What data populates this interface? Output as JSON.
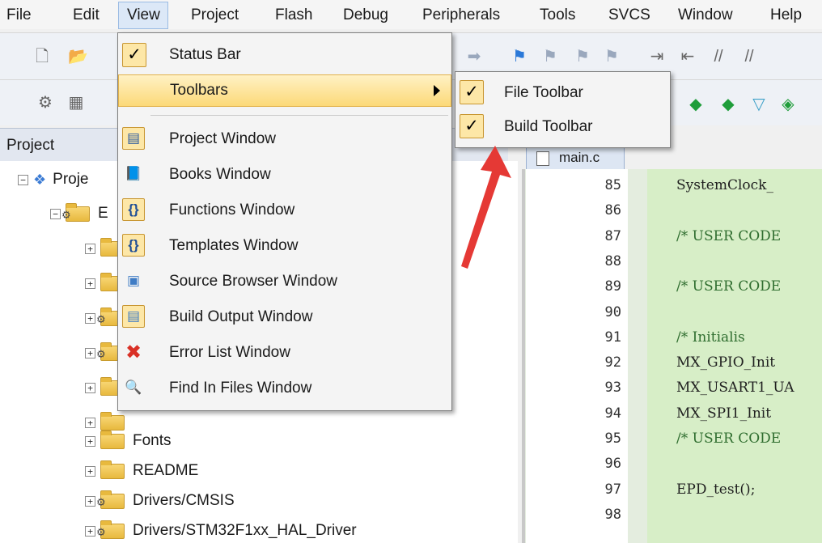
{
  "menubar": {
    "items": [
      "File",
      "Edit",
      "View",
      "Project",
      "Flash",
      "Debug",
      "Peripherals",
      "Tools",
      "SVCS",
      "Window",
      "Help"
    ]
  },
  "view_menu": {
    "status_bar": "Status Bar",
    "toolbars": "Toolbars",
    "items": [
      {
        "label": "Project Window",
        "icon": "project-window-icon"
      },
      {
        "label": "Books Window",
        "icon": "books-window-icon"
      },
      {
        "label": "Functions Window",
        "icon": "functions-window-icon"
      },
      {
        "label": "Templates Window",
        "icon": "templates-window-icon"
      },
      {
        "label": "Source Browser Window",
        "icon": "source-browser-icon"
      },
      {
        "label": "Build Output Window",
        "icon": "build-output-icon"
      },
      {
        "label": "Error List Window",
        "icon": "error-list-icon"
      },
      {
        "label": "Find In Files Window",
        "icon": "find-in-files-icon"
      }
    ]
  },
  "toolbars_submenu": {
    "file_toolbar": "File Toolbar",
    "build_toolbar": "Build Toolbar"
  },
  "checkmark": "✓",
  "project_pane": {
    "title": "Project",
    "root_label": "Proje",
    "target_label": "E",
    "folders": [
      "Fonts",
      "README",
      "Drivers/CMSIS",
      "Drivers/STM32F1xx_HAL_Driver"
    ]
  },
  "editor": {
    "tab_label": "main.c",
    "line_numbers": [
      "85",
      "86",
      "87",
      "88",
      "89",
      "90",
      "91",
      "92",
      "93",
      "94",
      "95",
      "96",
      "97",
      "98"
    ],
    "code_lines": [
      "SystemClock_",
      "",
      "/* USER CODE",
      "",
      "/* USER CODE",
      "",
      "/* Initialis",
      "MX_GPIO_Init",
      "MX_USART1_UA",
      "MX_SPI1_Init",
      "/* USER CODE",
      "",
      "EPD_test();",
      ""
    ]
  },
  "colors": {
    "menu_highlight": "#fcd978",
    "arrow": "#e53935",
    "code_background": "#d7eec7"
  }
}
